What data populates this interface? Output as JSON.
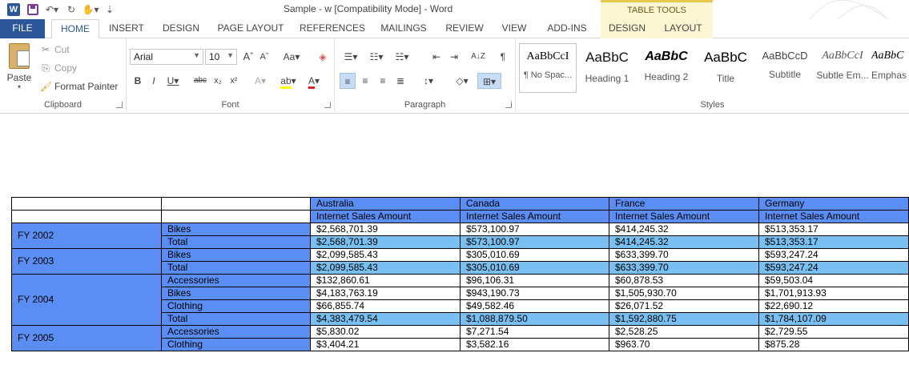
{
  "window": {
    "title": "Sample - w [Compatibility Mode] - Word",
    "context_header": "TABLE TOOLS"
  },
  "tabs": [
    "FILE",
    "HOME",
    "INSERT",
    "DESIGN",
    "PAGE LAYOUT",
    "REFERENCES",
    "MAILINGS",
    "REVIEW",
    "VIEW",
    "ADD-INS",
    "DESIGN",
    "LAYOUT"
  ],
  "ribbon": {
    "clipboard": {
      "label": "Clipboard",
      "paste": "Paste",
      "cut": "Cut",
      "copy": "Copy",
      "format_painter": "Format Painter"
    },
    "font": {
      "label": "Font",
      "font_name": "Arial",
      "font_size": "10"
    },
    "paragraph": {
      "label": "Paragraph"
    },
    "styles": {
      "label": "Styles",
      "items": [
        {
          "sample": "AaBbCcI",
          "name": "¶ No Spac..."
        },
        {
          "sample": "AaBbC",
          "name": "Heading 1"
        },
        {
          "sample": "AaBbC",
          "name": "Heading 2"
        },
        {
          "sample": "AaBbC",
          "name": "Title"
        },
        {
          "sample": "AaBbCcD",
          "name": "Subtitle"
        },
        {
          "sample": "AaBbCcI",
          "name": "Subtle Em..."
        },
        {
          "sample": "AaBbC",
          "name": "Emphas"
        }
      ]
    }
  },
  "table": {
    "countries": [
      "Australia",
      "Canada",
      "France",
      "Germany"
    ],
    "measure": "Internet Sales Amount",
    "years": [
      {
        "label": "FY 2002",
        "rows": [
          {
            "product": "Bikes",
            "values": [
              "$2,568,701.39",
              "$573,100.97",
              "$414,245.32",
              "$513,353.17"
            ]
          },
          {
            "product": "Total",
            "values": [
              "$2,568,701.39",
              "$573,100.97",
              "$414,245.32",
              "$513,353.17"
            ]
          }
        ]
      },
      {
        "label": "FY 2003",
        "rows": [
          {
            "product": "Bikes",
            "values": [
              "$2,099,585.43",
              "$305,010.69",
              "$633,399.70",
              "$593,247.24"
            ]
          },
          {
            "product": "Total",
            "values": [
              "$2,099,585.43",
              "$305,010.69",
              "$633,399.70",
              "$593,247.24"
            ]
          }
        ]
      },
      {
        "label": "FY 2004",
        "rows": [
          {
            "product": "Accessories",
            "values": [
              "$132,860.61",
              "$96,106.31",
              "$60,878.53",
              "$59,503.04"
            ]
          },
          {
            "product": "Bikes",
            "values": [
              "$4,183,763.19",
              "$943,190.73",
              "$1,505,930.70",
              "$1,701,913.93"
            ]
          },
          {
            "product": "Clothing",
            "values": [
              "$66,855.74",
              "$49,582.46",
              "$26,071.52",
              "$22,690.12"
            ]
          },
          {
            "product": "Total",
            "values": [
              "$4,383,479.54",
              "$1,088,879.50",
              "$1,592,880.75",
              "$1,784,107.09"
            ]
          }
        ]
      },
      {
        "label": "FY 2005",
        "rows": [
          {
            "product": "Accessories",
            "values": [
              "$5,830.02",
              "$7,271.54",
              "$2,528.25",
              "$2,729.55"
            ]
          },
          {
            "product": "Clothing",
            "values": [
              "$3,404.21",
              "$3,582.16",
              "$963.70",
              "$875.28"
            ]
          }
        ]
      }
    ]
  }
}
